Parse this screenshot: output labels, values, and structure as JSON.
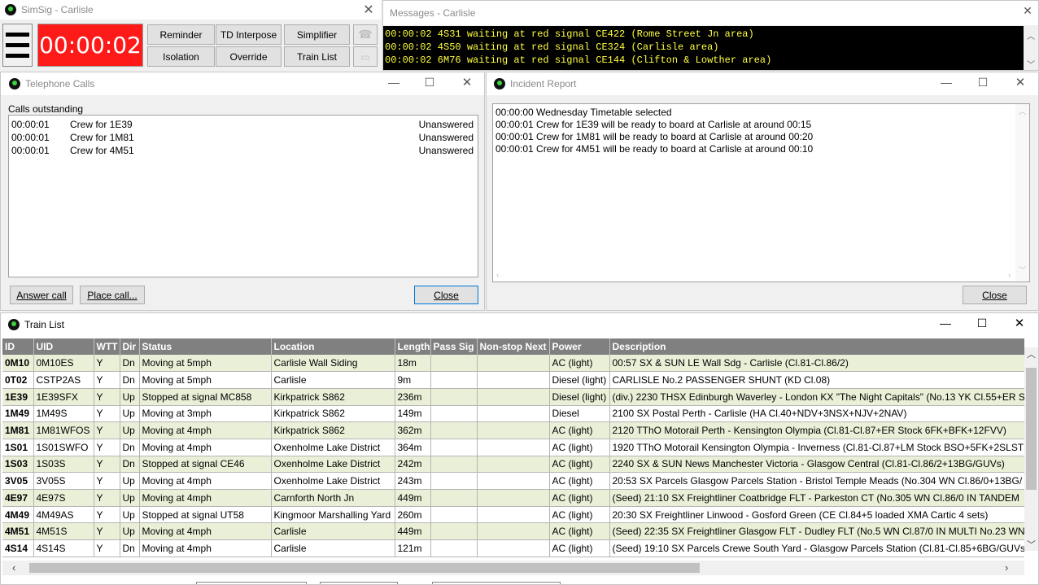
{
  "main_window": {
    "title": "SimSig - Carlisle",
    "clock": "00:00:02",
    "buttons": {
      "reminder": "Reminder",
      "td_interpose": "TD Interpose",
      "simplifier": "Simplifier",
      "isolation": "Isolation",
      "override": "Override",
      "train_list": "Train List"
    }
  },
  "messages": {
    "title": "Messages - Carlisle",
    "lines": [
      "00:00:02 4S31 waiting at red signal CE422 (Rome Street Jn area)",
      "00:00:02 4S50 waiting at red signal CE324 (Carlisle area)",
      "00:00:02 6M76 waiting at red signal CE144 (Clifton & Lowther area)"
    ],
    "text_color": "#ffff40"
  },
  "telephone": {
    "title": "Telephone Calls",
    "section_label": "Calls outstanding",
    "calls": [
      {
        "time": "00:00:01",
        "desc": "Crew for 1E39",
        "status": "Unanswered"
      },
      {
        "time": "00:00:01",
        "desc": "Crew for 1M81",
        "status": "Unanswered"
      },
      {
        "time": "00:00:01",
        "desc": "Crew for 4M51",
        "status": "Unanswered"
      }
    ],
    "answer_label": "Answer call",
    "place_label": "Place call...",
    "close_label": "Close"
  },
  "incident": {
    "title": "Incident Report",
    "lines": [
      "00:00:00 Wednesday Timetable selected",
      "00:00:01 Crew for 1E39 will be ready to board at Carlisle at around 00:15",
      "00:00:01 Crew for 1M81 will be ready to board at Carlisle at around 00:20",
      "00:00:01 Crew for 4M51 will be ready to board at Carlisle at around 00:10"
    ],
    "close_label": "Close"
  },
  "train_list": {
    "title": "Train List",
    "columns": [
      "ID",
      "UID",
      "WTT",
      "Dir",
      "Status",
      "Location",
      "Length",
      "Pass Sig",
      "Non-stop Next",
      "Power",
      "Description"
    ],
    "rows": [
      [
        "0M10",
        "0M10ES",
        "Y",
        "Dn",
        "Moving at 5mph",
        "Carlisle Wall Siding",
        "18m",
        "",
        "",
        "AC (light)",
        "00:57 SX & SUN LE Wall Sdg - Carlisle (Cl.81-Cl.86/2)"
      ],
      [
        "0T02",
        "CSTP2AS",
        "Y",
        "Dn",
        "Moving at 5mph",
        "Carlisle",
        "9m",
        "",
        "",
        "Diesel (light)",
        "CARLISLE No.2 PASSENGER SHUNT (KD Cl.08)"
      ],
      [
        "1E39",
        "1E39SFX",
        "Y",
        "Up",
        "Stopped at signal MC858",
        "Kirkpatrick S862",
        "236m",
        "",
        "",
        "Diesel (light)",
        "(div.) 2230 THSX Edinburgh Waverley - London KX \"The Night Capitals\" (No.13 YK Cl.55+ER S"
      ],
      [
        "1M49",
        "1M49S",
        "Y",
        "Up",
        "Moving at 3mph",
        "Kirkpatrick S862",
        "149m",
        "",
        "",
        "Diesel",
        "2100 SX Postal Perth - Carlisle (HA Cl.40+NDV+3NSX+NJV+2NAV)"
      ],
      [
        "1M81",
        "1M81WFOS",
        "Y",
        "Up",
        "Moving at 4mph",
        "Kirkpatrick S862",
        "362m",
        "",
        "",
        "AC (light)",
        "2120 TThO Motorail Perth - Kensington Olympia (Cl.81-Cl.87+ER Stock 6FK+BFK+12FVV)"
      ],
      [
        "1S01",
        "1S01SWFO",
        "Y",
        "Dn",
        "Moving at 4mph",
        "Oxenholme Lake District",
        "364m",
        "",
        "",
        "AC (light)",
        "1920 TThO Motorail Kensington Olympia - Inverness (Cl.81-Cl.87+LM Stock BSO+5FK+2SLST"
      ],
      [
        "1S03",
        "1S03S",
        "Y",
        "Dn",
        "Stopped at signal CE46",
        "Oxenholme Lake District",
        "242m",
        "",
        "",
        "AC (light)",
        "2240 SX & SUN News Manchester Victoria - Glasgow Central (Cl.81-Cl.86/2+13BG/GUVs)"
      ],
      [
        "3V05",
        "3V05S",
        "Y",
        "Up",
        "Moving at 4mph",
        "Oxenholme Lake District",
        "243m",
        "",
        "",
        "AC (light)",
        "20:53 SX Parcels Glasgow Parcels Station - Bristol Temple Meads (No.304 WN Cl.86/0+13BG/"
      ],
      [
        "4E97",
        "4E97S",
        "Y",
        "Up",
        "Moving at 4mph",
        "Carnforth North Jn",
        "449m",
        "",
        "",
        "AC (light)",
        "(Seed) 21:10 SX Freightliner Coatbridge FLT - Parkeston CT (No.305 WN Cl.86/0 IN TANDEM"
      ],
      [
        "4M49",
        "4M49AS",
        "Y",
        "Up",
        "Stopped at signal UT58",
        "Kingmoor Marshalling Yard",
        "260m",
        "",
        "",
        "AC (light)",
        "20:30 SX Freightliner Linwood - Gosford Green (CE Cl.84+5 loaded XMA Cartic 4 sets)"
      ],
      [
        "4M51",
        "4M51S",
        "Y",
        "Up",
        "Moving at 4mph",
        "Carlisle",
        "449m",
        "",
        "",
        "AC (light)",
        "(Seed) 22:35 SX Freightliner Glasgow FLT - Dudley FLT (No.5 WN Cl.87/0 IN MULTI No.23 WN"
      ],
      [
        "4S14",
        "4S14S",
        "Y",
        "Dn",
        "Moving at 4mph",
        "Carlisle",
        "121m",
        "",
        "",
        "AC (light)",
        "(Seed) 19:10 SX Parcels Crewe South Yard - Glasgow Parcels Station (Cl.81-Cl.85+6BG/GUVs"
      ]
    ]
  },
  "icons": {
    "menu": "hamburger-icon",
    "close": "close-icon",
    "minimize": "minimize-icon",
    "maximize": "maximize-icon",
    "phone": "telephone-icon"
  },
  "colors": {
    "clock_bg": "#ff0000",
    "header_bg": "#808080",
    "row_alt": "#eaf0d8"
  }
}
